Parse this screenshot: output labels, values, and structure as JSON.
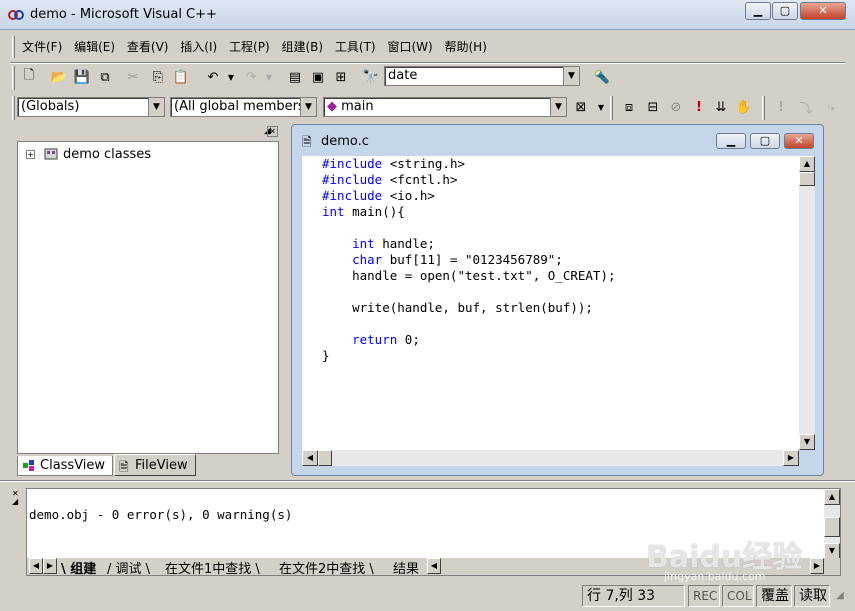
{
  "window": {
    "title": "demo - Microsoft Visual C++"
  },
  "menu": [
    "文件(F)",
    "编辑(E)",
    "查看(V)",
    "插入(I)",
    "工程(P)",
    "组建(B)",
    "工具(T)",
    "窗口(W)",
    "帮助(H)"
  ],
  "toolbar": {
    "find_value": "date"
  },
  "wizardbar": {
    "scope": "(Globals)",
    "members": "(All global members",
    "function": "main"
  },
  "workspace": {
    "tree_root": "demo classes",
    "tabs": [
      "ClassView",
      "FileView"
    ]
  },
  "editor": {
    "title": "demo.c",
    "lines": [
      {
        "kw": "#include",
        "rest": " <string.h>"
      },
      {
        "kw": "#include",
        "rest": " <fcntl.h>"
      },
      {
        "kw": "#include",
        "rest": " <io.h>"
      },
      {
        "kw": "int",
        "rest": " main(){"
      },
      {
        "kw": "",
        "rest": ""
      },
      {
        "kw": "    int",
        "rest": " handle;"
      },
      {
        "kw": "    char",
        "rest": " buf[11] = \"0123456789\";"
      },
      {
        "kw": "",
        "rest": "    handle = open(\"test.txt\", O_CREAT);"
      },
      {
        "kw": "",
        "rest": ""
      },
      {
        "kw": "",
        "rest": "    write(handle, buf, strlen(buf));"
      },
      {
        "kw": "",
        "rest": ""
      },
      {
        "kw": "    return",
        "rest": " 0;"
      },
      {
        "kw": "",
        "rest": "}"
      }
    ]
  },
  "output": {
    "text": "demo.obj - 0 error(s), 0 warning(s)",
    "tabs": [
      "组建",
      "调试",
      "在文件1中查找",
      "在文件2中查找",
      "结果"
    ]
  },
  "status": {
    "position": "行 7,列 33",
    "rec": "REC",
    "col": "COL",
    "ovr": "覆盖",
    "read": "读取"
  },
  "watermark": {
    "text": "Baidu经验",
    "sub": "jingyan.baidu.com"
  }
}
